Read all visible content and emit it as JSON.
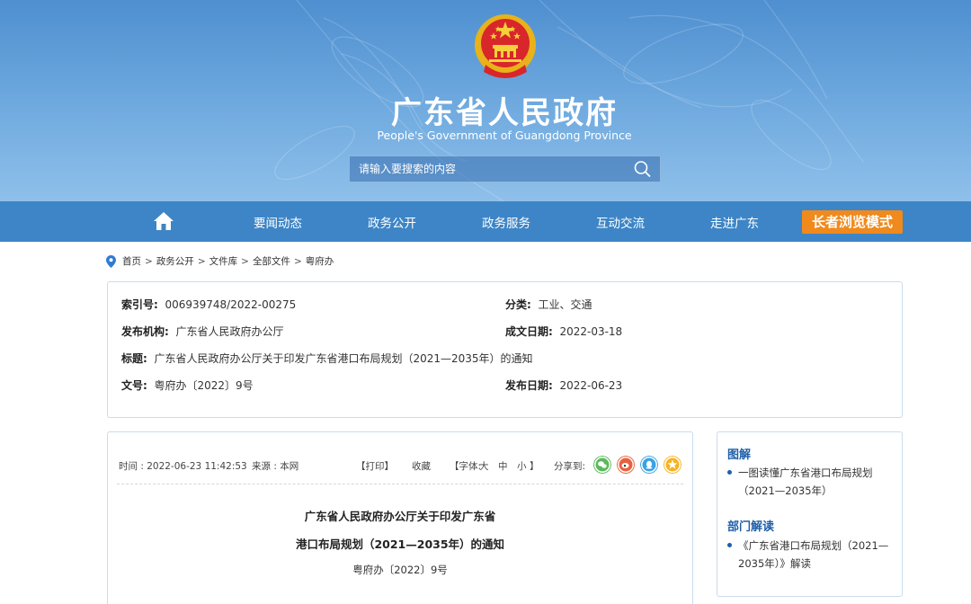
{
  "header": {
    "title": "广东省人民政府",
    "subtitle": "People's Government of Guangdong Province",
    "search_placeholder": "请输入要搜索的内容"
  },
  "nav": {
    "items": [
      "要闻动态",
      "政务公开",
      "政务服务",
      "互动交流",
      "走进广东"
    ],
    "elder_mode": "长者浏览模式"
  },
  "breadcrumb": [
    "首页",
    "政务公开",
    "文件库",
    "全部文件",
    "粤府办"
  ],
  "info": {
    "index_label": "索引号:",
    "index_value": "006939748/2022-00275",
    "category_label": "分类:",
    "category_value": "工业、交通",
    "publisher_label": "发布机构:",
    "publisher_value": "广东省人民政府办公厅",
    "created_label": "成文日期:",
    "created_value": "2022-03-18",
    "title_label": "标题:",
    "title_value": "广东省人民政府办公厅关于印发广东省港口布局规划（2021—2035年）的通知",
    "docno_label": "文号:",
    "docno_value": "粤府办〔2022〕9号",
    "published_label": "发布日期:",
    "published_value": "2022-06-23"
  },
  "article": {
    "time": "时间 : 2022-06-23 11:42:53",
    "source": "来源 : 本网",
    "print": "【打印】",
    "favorite": "收藏",
    "font_open": "【字体:",
    "font_large": "大",
    "font_medium": "中",
    "font_small": "小",
    "font_close": "】",
    "share_label": "分享到:",
    "title_line1": "广东省人民政府办公厅关于印发广东省",
    "title_line2": "港口布局规划（2021—2035年）的通知",
    "doc_number": "粤府办〔2022〕9号"
  },
  "sidebar": {
    "section1_title": "图解",
    "section1_link": "一图读懂广东省港口布局规划（2021—2035年）",
    "section2_title": "部门解读",
    "section2_link": "《广东省港口布局规划（2021—2035年）》解读"
  },
  "colors": {
    "nav_bg": "#3d85c6",
    "elder_btn": "#f08a1c",
    "wechat": "#5cb85c",
    "weibo": "#e8613d",
    "qq": "#3aa3e3",
    "qzone": "#f5b323"
  },
  "icons": {
    "emblem": "national-emblem-icon",
    "search": "search-icon",
    "home": "home-icon",
    "location": "location-pin-icon",
    "share": [
      "wechat-icon",
      "weibo-icon",
      "qq-icon",
      "qzone-icon"
    ]
  }
}
